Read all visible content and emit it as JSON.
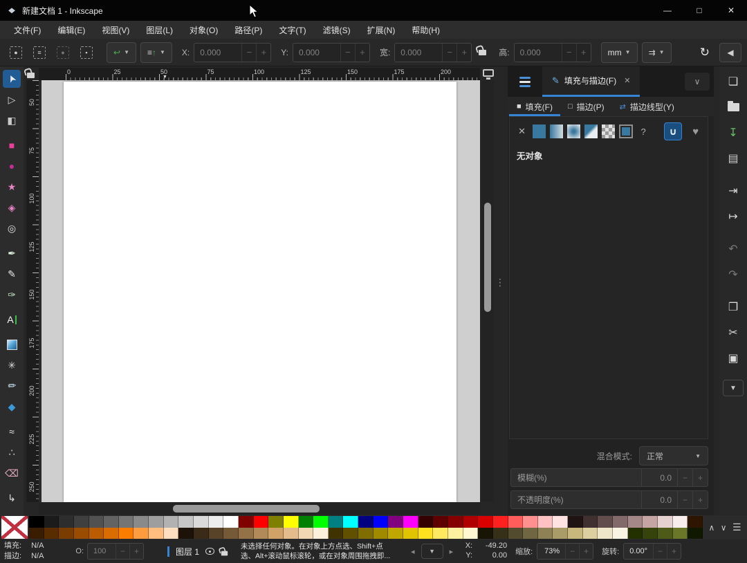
{
  "window": {
    "title": "新建文档 1 - Inkscape"
  },
  "icons": {
    "logo": "◆",
    "minimize": "—",
    "maximize": "□",
    "close": "✕",
    "collapse_right": "◀",
    "snap": "↻",
    "dock_collapse": "∨",
    "palette_up": "∧",
    "palette_down": "∨",
    "palette_menu": "☰",
    "nav_prev": "◂",
    "nav_next": "▸",
    "nav_dd": "▼",
    "ruler_marker": "▼"
  },
  "menubar": {
    "items": [
      "文件(F)",
      "编辑(E)",
      "视图(V)",
      "图层(L)",
      "对象(O)",
      "路径(P)",
      "文字(T)",
      "滤镜(S)",
      "扩展(N)",
      "帮助(H)"
    ]
  },
  "toolbar": {
    "x_label": "X:",
    "x_value": "0.000",
    "y_label": "Y:",
    "y_value": "0.000",
    "w_label": "宽:",
    "w_value": "0.000",
    "h_label": "高:",
    "h_value": "0.000",
    "unit": "mm"
  },
  "tools": [
    {
      "id": "selector",
      "glyph": "➤",
      "color": "#ededed",
      "active": true,
      "rot": -115
    },
    {
      "id": "node-editor",
      "glyph": "▷",
      "color": "#dcdcdc"
    },
    {
      "id": "shape-builder",
      "glyph": "◧",
      "color": "#c9c9c9"
    },
    {
      "id": "rectangle",
      "glyph": "■",
      "color": "#ec3f9d",
      "gap": true
    },
    {
      "id": "ellipse",
      "glyph": "●",
      "color": "#c42e92"
    },
    {
      "id": "star",
      "glyph": "★",
      "color": "#e884c4"
    },
    {
      "id": "box-3d",
      "glyph": "◈",
      "color": "#e884c4"
    },
    {
      "id": "spiral",
      "glyph": "◎",
      "color": "#e0e0e0"
    },
    {
      "id": "pen",
      "glyph": "✒",
      "color": "#dff0df",
      "gap": true
    },
    {
      "id": "pencil",
      "glyph": "✎",
      "color": "#e8e8e8"
    },
    {
      "id": "calligraphy",
      "glyph": "✑",
      "color": "#bfe3bf"
    },
    {
      "id": "text",
      "glyph": "A",
      "color": "#f2f2f2",
      "caret": true,
      "gap": true
    },
    {
      "id": "gradient",
      "box": true,
      "gap": true
    },
    {
      "id": "mesh-gradient",
      "glyph": "✳",
      "color": "#dcdcdc"
    },
    {
      "id": "dropper",
      "glyph": "✐",
      "color": "#cfe8f7",
      "rot": 40
    },
    {
      "id": "paint-bucket",
      "glyph": "◆",
      "color": "#3a9ad9"
    },
    {
      "id": "tweak",
      "glyph": "≈",
      "color": "#e8e8e8",
      "gap": true
    },
    {
      "id": "spray",
      "glyph": "∴",
      "color": "#dcdcdc"
    },
    {
      "id": "eraser",
      "glyph": "⌫",
      "color": "#e3aebf"
    },
    {
      "id": "connector",
      "glyph": "↳",
      "color": "#e0e0e0",
      "gap": true
    }
  ],
  "rulers": {
    "horizontal": [
      "0",
      "25",
      "50",
      "75",
      "100",
      "125",
      "150",
      "175",
      "200"
    ],
    "vertical": [
      "50",
      "75",
      "100",
      "125",
      "150",
      "175",
      "200",
      "225",
      "250"
    ]
  },
  "dock": {
    "tab_label": "填充与描边(F)",
    "tab_close": "✕",
    "subtabs": [
      {
        "id": "fill",
        "label": "填充(F)",
        "icon": "■",
        "active": true
      },
      {
        "id": "stroke-paint",
        "label": "描边(P)",
        "icon": "□",
        "active": false
      },
      {
        "id": "stroke-style",
        "label": "描边线型(Y)",
        "icon": "⇄",
        "active": false
      }
    ],
    "paint_buttons": [
      {
        "name": "paint-none",
        "kind": "none",
        "glyph": "✕"
      },
      {
        "name": "paint-flat",
        "kind": "flat"
      },
      {
        "name": "paint-linear-gradient",
        "kind": "linear"
      },
      {
        "name": "paint-radial-gradient",
        "kind": "radial"
      },
      {
        "name": "paint-mesh-gradient",
        "kind": "mesh"
      },
      {
        "name": "paint-pattern",
        "kind": "pattern"
      },
      {
        "name": "paint-swatch",
        "kind": "swatch"
      },
      {
        "name": "paint-unknown",
        "kind": "unknown",
        "glyph": "?"
      },
      {
        "name": "fill-rule-evenodd",
        "kind": "evenodd",
        "glyph": "∪"
      },
      {
        "name": "fill-rule-nonzero",
        "kind": "nonzero",
        "glyph": "♥"
      }
    ],
    "no_object": "无对象",
    "blend_label": "混合模式:",
    "blend_value": "正常",
    "blur_label": "模糊(%)",
    "blur_value": "0.0",
    "opacity_label": "不透明度(%)",
    "opacity_value": "0.0"
  },
  "command_bar": [
    {
      "name": "new-document",
      "glyph": "❏"
    },
    {
      "name": "open-folder",
      "folder": true
    },
    {
      "name": "save",
      "glyph": "↧",
      "color": "#6abf69"
    },
    {
      "name": "print",
      "glyph": "▤",
      "color": "#c9c9c9"
    },
    {
      "name": "import",
      "glyph": "⇥",
      "gap": true
    },
    {
      "name": "export",
      "glyph": "↦"
    },
    {
      "name": "undo",
      "glyph": "↶",
      "color": "#787878",
      "gap": true
    },
    {
      "name": "redo",
      "glyph": "↷",
      "color": "#787878"
    },
    {
      "name": "copy",
      "glyph": "❐",
      "gap": true
    },
    {
      "name": "cut",
      "glyph": "✂"
    },
    {
      "name": "paste",
      "glyph": "▣"
    }
  ],
  "palette": {
    "row1": [
      "#000000",
      "#1b1b1b",
      "#2d2d2d",
      "#3f3f3f",
      "#515151",
      "#636363",
      "#757575",
      "#8a8a8a",
      "#9e9e9e",
      "#b2b2b2",
      "#c6c6c6",
      "#dadada",
      "#ededed",
      "#ffffff",
      "#800000",
      "#ff0000",
      "#808000",
      "#ffff00",
      "#008000",
      "#00ff00",
      "#008080",
      "#00ffff",
      "#000080",
      "#0000ff",
      "#800080",
      "#ff00ff",
      "#350000",
      "#5e0000",
      "#870000",
      "#b00000",
      "#d90000",
      "#ff2020",
      "#ff5c5c",
      "#ff9090",
      "#ffc2c2",
      "#ffe3e3",
      "#201313",
      "#413030",
      "#624d4d",
      "#836a6a",
      "#a48787",
      "#c5a4a4",
      "#e6d1d1",
      "#f7eded",
      "#2e1500"
    ],
    "row2": [
      "#3a1d00",
      "#5a2d00",
      "#7a3d00",
      "#9a4d00",
      "#ba5d00",
      "#da6d00",
      "#fa7d00",
      "#ff9c40",
      "#ffbe80",
      "#ffdfbf",
      "#1c1208",
      "#3a2a18",
      "#584228",
      "#765a38",
      "#947248",
      "#b28a58",
      "#d0a268",
      "#e4bc8c",
      "#f1d7b4",
      "#fbf0dc",
      "#403300",
      "#605000",
      "#806d00",
      "#a08a00",
      "#c0a700",
      "#e0c400",
      "#ffe120",
      "#ffe960",
      "#fff1a0",
      "#fff8d0",
      "#191505",
      "#363019",
      "#534b2d",
      "#706641",
      "#8d8155",
      "#aa9c69",
      "#c7b77d",
      "#ddcfa0",
      "#efe5c8",
      "#f9f4e4",
      "#233000",
      "#36430a",
      "#4e5a18",
      "#6a7628",
      "#101800"
    ]
  },
  "statusbar": {
    "fill_label": "填充:",
    "fill_value": "N/A",
    "stroke_label": "描边:",
    "stroke_value": "N/A",
    "o_label": "O:",
    "o_value": "100",
    "layer_name": "图层 1",
    "message_line1": "未选择任何对象。在对象上方点选、Shift+点",
    "message_line2": "选、Alt+滚动鼠标滚轮，或在对象周围拖拽即...",
    "x_label": "X:",
    "x_value": "-49.20",
    "y_label": "Y:",
    "y_value": "0.00",
    "zoom_label": "缩放:",
    "zoom_value": "73%",
    "rotation_label": "旋转:",
    "rotation_value": "0.00°"
  }
}
